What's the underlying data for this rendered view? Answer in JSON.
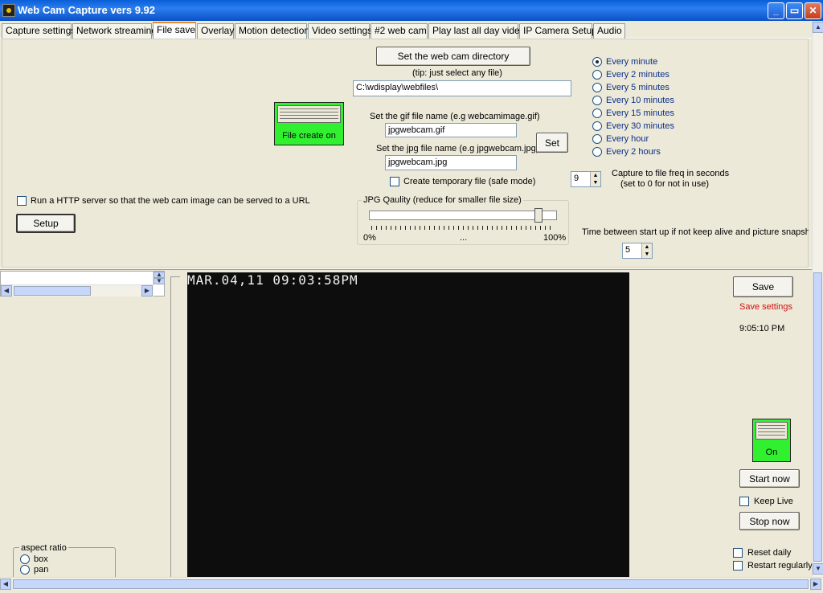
{
  "window": {
    "title": "Web Cam Capture vers 9.92"
  },
  "tabs": [
    {
      "label": "Capture settings"
    },
    {
      "label": "Network streaming"
    },
    {
      "label": "File save",
      "active": true
    },
    {
      "label": "Overlay"
    },
    {
      "label": "Motion detection"
    },
    {
      "label": "Video settings"
    },
    {
      "label": "#2 web cam"
    },
    {
      "label": "Play last all day video"
    },
    {
      "label": "IP Camera Setup"
    },
    {
      "label": "Audio"
    }
  ],
  "file_save": {
    "set_dir_button": "Set the web cam directory",
    "tip": "(tip: just select any file)",
    "directory": "C:\\wdisplay\\webfiles\\",
    "file_create_indicator": "File create on",
    "gif_label": "Set the gif file name (e.g webcamimage.gif)",
    "gif_value": "jpgwebcam.gif",
    "jpg_label": "Set the jpg file name (e.g jpgwebcam.jpg)",
    "jpg_value": "jpgwebcam.jpg",
    "set_button": "Set",
    "temp_file_label": "Create temporary file (safe mode)",
    "http_server_label": "Run a HTTP server so that the web cam image can be served to a URL",
    "setup_button": "Setup",
    "jpg_quality": {
      "title": "JPG Qaulity  (reduce for smaller file size)",
      "min_label": "0%",
      "mid_label": "...",
      "max_label": "100%",
      "value_percent": 92
    },
    "frequency_options": [
      {
        "label": "Every minute",
        "selected": true
      },
      {
        "label": "Every 2 minutes"
      },
      {
        "label": "Every 5 minutes"
      },
      {
        "label": "Every 10 minutes"
      },
      {
        "label": "Every 15 minutes"
      },
      {
        "label": "Every 30 minutes"
      },
      {
        "label": "Every hour"
      },
      {
        "label": "Every 2 hours"
      }
    ],
    "capture_freq_value": "9",
    "capture_freq_label_1": "Capture to file freq in seconds",
    "capture_freq_label_2": "(set to 0 for not in use)",
    "startup_label": "Time between start up if not keep alive and picture snapsho",
    "startup_value": "5"
  },
  "video": {
    "timestamp": "MAR.04,11  09:03:58PM"
  },
  "right_panel": {
    "save_button": "Save",
    "save_settings": "Save settings",
    "clock": "9:05:10 PM",
    "on_indicator": "On",
    "start_now": "Start now",
    "keep_live": "Keep Live",
    "stop_now": "Stop now",
    "reset_daily": "Reset daily",
    "restart_regularly": "Restart regularly"
  },
  "aspect_ratio": {
    "title": "aspect ratio",
    "options": [
      "box",
      "pan"
    ]
  },
  "colors": {
    "accent_green": "#30f030",
    "title_blue": "#0a5fd8",
    "save_red": "#d01010"
  }
}
